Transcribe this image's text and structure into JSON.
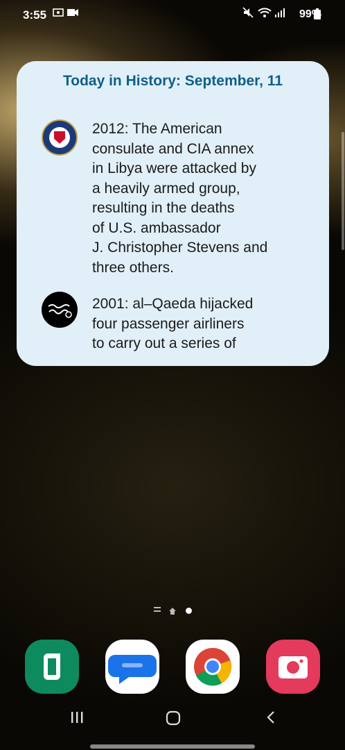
{
  "status": {
    "time": "3:55",
    "battery": "99%"
  },
  "widget": {
    "title": "Today in History: September, 11",
    "entries": [
      {
        "text": "2012: The American\nconsulate and CIA annex\nin Libya were attacked by\na heavily armed group,\nresulting in the deaths\nof U.S. ambassador\nJ. Christopher Stevens and\nthree others.",
        "icon": "cia-seal-icon"
      },
      {
        "text": "2001: al–Qaeda hijacked\nfour passenger airliners\nto carry out a series of",
        "icon": "al-qaeda-flag-icon"
      }
    ]
  },
  "dock": {
    "apps": [
      "phone",
      "messages",
      "chrome",
      "camera"
    ]
  },
  "navigation": {
    "recents": "recents-icon",
    "home": "home-icon",
    "back": "back-icon"
  },
  "colors": {
    "widget_bg": "#e1f0f8",
    "title": "#0f5f87",
    "phone": "#0e8a5f",
    "camera": "#e43a5c"
  }
}
